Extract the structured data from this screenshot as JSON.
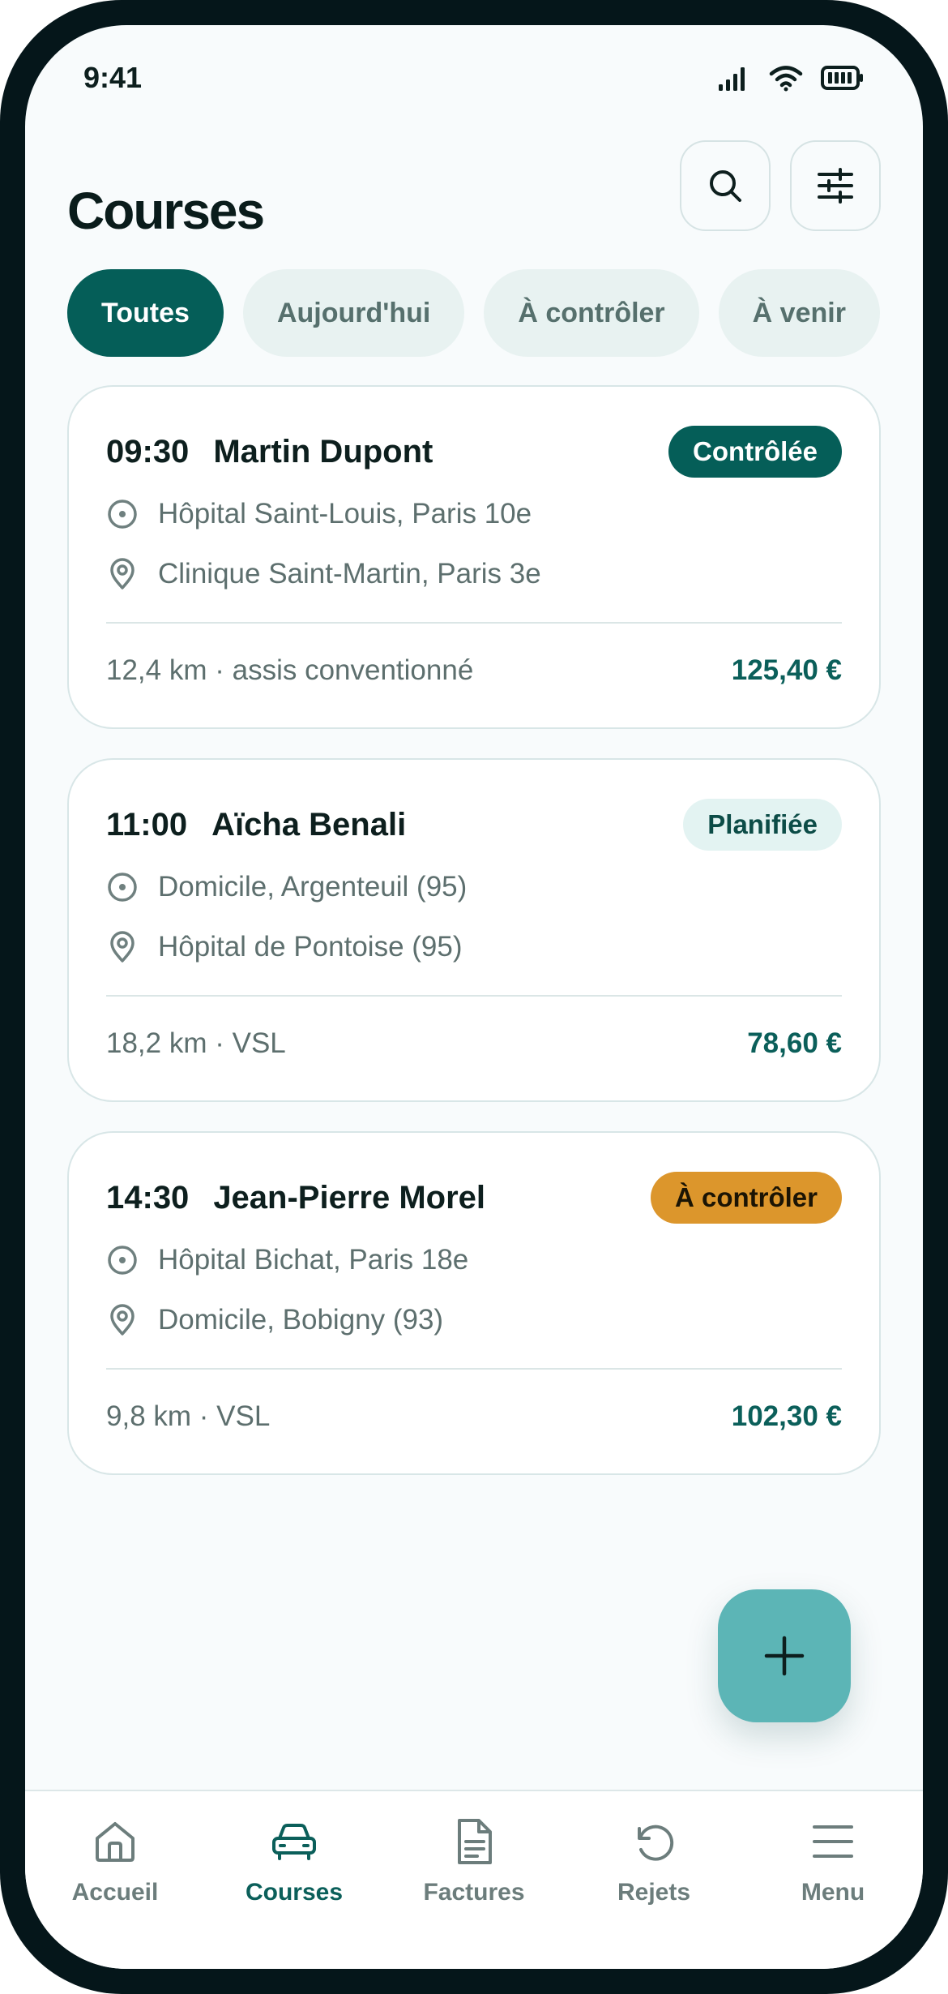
{
  "status_bar": {
    "time": "9:41"
  },
  "header": {
    "title": "Courses"
  },
  "filters": {
    "chips": [
      {
        "label": "Toutes",
        "active": true
      },
      {
        "label": "Aujourd'hui",
        "active": false
      },
      {
        "label": "À contrôler",
        "active": false
      },
      {
        "label": "À venir",
        "active": false
      }
    ]
  },
  "rides": [
    {
      "time": "09:30",
      "patient": "Martin Dupont",
      "status": "Contrôlée",
      "from": "Hôpital Saint-Louis, Paris 10e",
      "to": "Clinique Saint-Martin, Paris 3e",
      "meta": "12,4 km · assis conventionné",
      "price": "125,40 €"
    },
    {
      "time": "11:00",
      "patient": "Aïcha Benali",
      "status": "Planifiée",
      "from": "Domicile, Argenteuil (95)",
      "to": "Hôpital de Pontoise (95)",
      "meta": "18,2 km · VSL",
      "price": "78,60 €"
    },
    {
      "time": "14:30",
      "patient": "Jean-Pierre Morel",
      "status": "À contrôler",
      "from": "Hôpital Bichat, Paris 18e",
      "to": "Domicile, Bobigny (93)",
      "meta": "9,8 km · VSL",
      "price": "102,30 €"
    }
  ],
  "tabbar": {
    "items": [
      {
        "label": "Accueil",
        "icon": "home-icon",
        "active": false
      },
      {
        "label": "Courses",
        "icon": "car-icon",
        "active": true
      },
      {
        "label": "Factures",
        "icon": "document-icon",
        "active": false
      },
      {
        "label": "Rejets",
        "icon": "rotate-icon",
        "active": false
      },
      {
        "label": "Menu",
        "icon": "menu-icon",
        "active": false
      }
    ]
  },
  "colors": {
    "primary": "#055e58",
    "accent_fab": "#5cb5b6",
    "warning": "#dc962c",
    "background": "#f8fbfc"
  }
}
